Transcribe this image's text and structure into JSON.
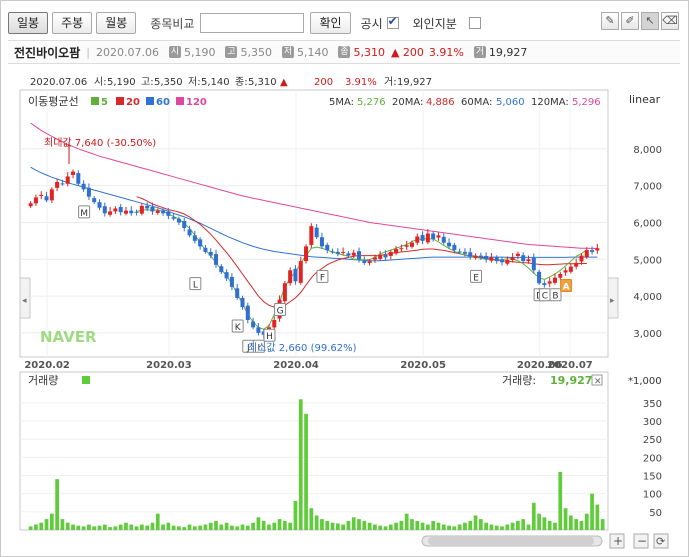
{
  "toolbar": {
    "buttons": [
      "일봉",
      "주봉",
      "월봉"
    ],
    "compare_label": "종목비교",
    "confirm_label": "확인",
    "disclosure_label": "공시",
    "foreign_label": "외인지분"
  },
  "info": {
    "name": "전진바이오팜",
    "date": "2020.07.06",
    "open_badge": "시",
    "open": "5,190",
    "high_badge": "고",
    "high": "5,350",
    "low_badge": "저",
    "low": "5,140",
    "close_badge": "종",
    "close": "5,310",
    "change": "▲ 200",
    "change_pct": "3.91%",
    "volume_badge": "거",
    "volume": "19,927"
  },
  "price_panel": {
    "header_date": "2020.07.06",
    "o_label": "시:",
    "o": "5,190",
    "h_label": "고:",
    "h": "5,350",
    "l_label": "저:",
    "l": "5,140",
    "c_label": "종:",
    "c": "5,310",
    "chg": "200",
    "chg_pct": "3.91%",
    "v_label": "거:",
    "v": "19,927",
    "ma_label": "이동평균선",
    "ma_periods": [
      "5",
      "20",
      "60",
      "120"
    ],
    "ma_values": [
      {
        "label": "5MA:",
        "value": "5,276",
        "color": "#5fb139"
      },
      {
        "label": "20MA:",
        "value": "4,886",
        "color": "#d42a2a"
      },
      {
        "label": "60MA:",
        "value": "5,060",
        "color": "#2f74d0"
      },
      {
        "label": "120MA:",
        "value": "5,296",
        "color": "#e0479e"
      }
    ],
    "scale_mode": "linear",
    "max_label": "최대값 7,640 (-30.50%)",
    "min_label": "최소값 2,660 (99.62%)",
    "watermark": "NAVER",
    "markers": [
      "M",
      "L",
      "K",
      "J",
      "I",
      "H",
      "G",
      "F",
      "E",
      "D",
      "C",
      "B",
      "A"
    ]
  },
  "volume_panel": {
    "label": "거래량",
    "current_label": "거래량:",
    "current_value": "19,927",
    "unit": "*1,000"
  },
  "chart_data": [
    {
      "type": "candlestick",
      "x_labels": [
        "2020.02",
        "2020.03",
        "2020.04",
        "2020.05",
        "2020.06",
        "2020.07"
      ],
      "ylim": [
        2400,
        9000
      ],
      "yticks": [
        3000,
        4000,
        5000,
        6000,
        7000,
        8000
      ],
      "ytick_labels": [
        "3,000",
        "4,000",
        "5,000",
        "6,000",
        "7,000",
        "8,000"
      ],
      "max_point": 7640,
      "min_point": 2660,
      "colors": {
        "up": "#e02424",
        "down": "#2f6fd0",
        "ma5": "#5fb139",
        "ma20": "#d42a2a",
        "ma60": "#2f74d0",
        "ma120": "#e0479e"
      },
      "series": {
        "close": [
          6520,
          6680,
          6750,
          6600,
          6900,
          7100,
          7050,
          7250,
          7380,
          7050,
          6900,
          6700,
          6550,
          6400,
          6250,
          6300,
          6380,
          6280,
          6320,
          6250,
          6280,
          6450,
          6380,
          6300,
          6320,
          6250,
          6180,
          6100,
          6000,
          5850,
          5650,
          5500,
          5350,
          5200,
          5100,
          4850,
          4650,
          4480,
          4250,
          3950,
          3700,
          3350,
          3150,
          3000,
          2950,
          3150,
          3350,
          3900,
          4350,
          4700,
          4400,
          4950,
          5350,
          5900,
          5600,
          5350,
          5250,
          5200,
          5150,
          5200,
          5100,
          5180,
          5000,
          4900,
          4950,
          5050,
          5120,
          5050,
          5200,
          5280,
          5300,
          5380,
          5450,
          5620,
          5500,
          5700,
          5550,
          5650,
          5450,
          5350,
          5250,
          5200,
          5150,
          5080,
          5100,
          5050,
          5000,
          5050,
          4950,
          4920,
          4980,
          5050,
          5150,
          4950,
          5000,
          4700,
          4350,
          4300,
          4400,
          4500,
          4600,
          4700,
          4800,
          4900,
          5100,
          5250,
          5200,
          5300
        ],
        "ma5": [
          null,
          null,
          null,
          null,
          null,
          null,
          null,
          null,
          null,
          null,
          null,
          null,
          null,
          null,
          null,
          null,
          null,
          null,
          null,
          null,
          6300,
          6330,
          6350,
          6330,
          6340,
          6300,
          6230,
          6160,
          6090,
          5980,
          5840,
          5660,
          5450,
          5250,
          5100,
          4900,
          4720,
          4550,
          4330,
          4060,
          3800,
          3500,
          3300,
          3150,
          3100,
          3200,
          3500,
          3850,
          4250,
          4500,
          4650,
          4900,
          5100,
          5300,
          5330,
          5300,
          5250,
          5200,
          5150,
          5120,
          5080,
          5000,
          5000,
          4980,
          4990,
          5050,
          5150,
          5200,
          5250,
          5300,
          5350,
          5400,
          5480,
          5540,
          5550,
          5560,
          5550,
          5470,
          5380,
          5290,
          5220,
          5160,
          5110,
          5080,
          5050,
          5030,
          5000,
          4990,
          4980,
          4990,
          5010,
          5010,
          4960,
          4880,
          4760,
          4620,
          4500,
          4450,
          4520,
          4600,
          4700,
          4820,
          4950,
          5080,
          5160,
          5250
        ],
        "ma20": [
          null,
          null,
          null,
          null,
          null,
          null,
          null,
          null,
          null,
          null,
          null,
          null,
          null,
          null,
          null,
          null,
          null,
          null,
          null,
          null,
          6700,
          6650,
          6580,
          6500,
          6450,
          6400,
          6350,
          6320,
          6280,
          6230,
          6150,
          6050,
          5950,
          5820,
          5680,
          5520,
          5350,
          5180,
          5000,
          4800,
          4600,
          4400,
          4200,
          4000,
          3850,
          3750,
          3700,
          3700,
          3750,
          3850,
          3950,
          4100,
          4300,
          4500,
          4650,
          4750,
          4850,
          4920,
          4980,
          5020,
          5050,
          5080,
          5100,
          5100,
          5100,
          5100,
          5110,
          5130,
          5160,
          5180,
          5200,
          5210,
          5230,
          5250,
          5270,
          5280,
          5280,
          5260,
          5240,
          5210,
          5180,
          5150,
          5120,
          5100,
          5080,
          5050,
          5030,
          5000,
          4980,
          4960,
          4940,
          4930,
          4920,
          4910,
          4900,
          4880,
          4860,
          4850,
          4850,
          4860,
          4870,
          4880,
          4880,
          4880,
          4886,
          4886
        ],
        "ma60": [
          7500,
          7420,
          7350,
          7290,
          7230,
          7180,
          7130,
          7080,
          7040,
          7000,
          6960,
          6920,
          6880,
          6840,
          6800,
          6760,
          6720,
          6680,
          6640,
          6600,
          6560,
          6520,
          6480,
          6440,
          6400,
          6350,
          6300,
          6250,
          6200,
          6150,
          6100,
          6040,
          5980,
          5910,
          5840,
          5770,
          5700,
          5630,
          5570,
          5510,
          5450,
          5400,
          5350,
          5310,
          5270,
          5240,
          5210,
          5190,
          5170,
          5150,
          5130,
          5110,
          5090,
          5070,
          5060,
          5050,
          5040,
          5030,
          5020,
          5010,
          5000,
          4990,
          4980,
          4970,
          4960,
          4960,
          4960,
          4970,
          4980,
          4990,
          5000,
          5010,
          5020,
          5030,
          5040,
          5050,
          5060,
          5060,
          5060,
          5060,
          5060,
          5060,
          5060,
          5060,
          5060,
          5060,
          5060,
          5060,
          5060,
          5060,
          5050,
          5050,
          5050,
          5050,
          5050,
          5050,
          5050,
          5050,
          5050,
          5050,
          5050,
          5050,
          5060,
          5060,
          5060,
          5060,
          5060,
          5060
        ],
        "ma120": [
          8700,
          8600,
          8500,
          8420,
          8340,
          8260,
          8190,
          8120,
          8060,
          8000,
          7950,
          7900,
          7850,
          7800,
          7760,
          7720,
          7680,
          7640,
          7600,
          7560,
          7520,
          7480,
          7440,
          7400,
          7360,
          7320,
          7280,
          7240,
          7200,
          7160,
          7120,
          7080,
          7040,
          7000,
          6960,
          6920,
          6880,
          6840,
          6800,
          6760,
          6720,
          6690,
          6660,
          6630,
          6600,
          6570,
          6540,
          6510,
          6480,
          6450,
          6420,
          6390,
          6360,
          6330,
          6300,
          6270,
          6240,
          6210,
          6180,
          6150,
          6120,
          6090,
          6060,
          6030,
          6000,
          5980,
          5960,
          5940,
          5920,
          5900,
          5880,
          5860,
          5840,
          5820,
          5800,
          5780,
          5760,
          5740,
          5720,
          5700,
          5680,
          5660,
          5640,
          5620,
          5600,
          5580,
          5560,
          5540,
          5520,
          5500,
          5480,
          5460,
          5440,
          5420,
          5400,
          5390,
          5380,
          5370,
          5360,
          5350,
          5340,
          5330,
          5320,
          5310,
          5300,
          5300,
          5296,
          5296
        ]
      }
    },
    {
      "type": "bar",
      "ylim": [
        0,
        380
      ],
      "yticks": [
        50,
        100,
        150,
        200,
        250,
        300,
        350
      ],
      "values": [
        10,
        15,
        20,
        30,
        45,
        140,
        30,
        20,
        15,
        12,
        10,
        15,
        10,
        12,
        15,
        8,
        10,
        15,
        20,
        15,
        10,
        15,
        12,
        20,
        45,
        15,
        20,
        12,
        10,
        8,
        15,
        10,
        12,
        15,
        20,
        25,
        15,
        20,
        12,
        10,
        15,
        12,
        20,
        35,
        25,
        15,
        20,
        30,
        25,
        20,
        80,
        360,
        320,
        60,
        40,
        30,
        25,
        20,
        18,
        15,
        25,
        35,
        30,
        25,
        20,
        15,
        12,
        10,
        15,
        20,
        25,
        45,
        30,
        25,
        20,
        15,
        25,
        20,
        15,
        12,
        10,
        15,
        20,
        25,
        40,
        30,
        20,
        15,
        12,
        10,
        15,
        20,
        25,
        30,
        15,
        75,
        45,
        35,
        25,
        20,
        160,
        60,
        40,
        30,
        25,
        45,
        100,
        70,
        30
      ]
    }
  ]
}
